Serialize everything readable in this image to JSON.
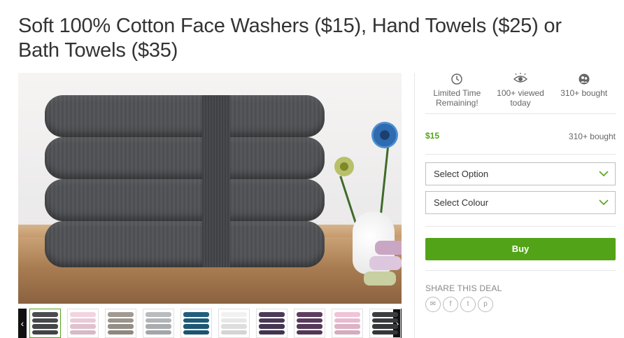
{
  "deal": {
    "title": "Soft 100% Cotton Face Washers ($15), Hand Towels ($25) or Bath Towels ($35)"
  },
  "gallery": {
    "prev_arrow": "‹",
    "next_arrow": "›",
    "thumbnail_colors": [
      "#4b4c4f",
      "#f2d3e0",
      "#a09a92",
      "#b9bcbf",
      "#1f5f7d",
      "#f1f1f1",
      "#4b3b5a",
      "#5e3d61",
      "#f0c3d7",
      "#3c3d40"
    ]
  },
  "stats": {
    "time": {
      "icon": "clock-icon",
      "line1": "Limited Time",
      "line2": "Remaining!"
    },
    "viewed": {
      "icon": "eye-icon",
      "line1": "100+ viewed",
      "line2": "today"
    },
    "bought": {
      "icon": "bought-icon",
      "line1": "310+ bought"
    }
  },
  "pricing": {
    "price": "$15",
    "bought": "310+ bought",
    "accent_color": "#53a318"
  },
  "options": {
    "option_select": "Select Option",
    "colour_select": "Select Colour"
  },
  "actions": {
    "buy_label": "Buy"
  },
  "share": {
    "title": "SHARE THIS DEAL",
    "icons": [
      "email-icon",
      "facebook-icon",
      "twitter-icon",
      "pinterest-icon"
    ],
    "glyphs": {
      "email": "✉",
      "facebook": "f",
      "twitter": "t",
      "pinterest": "p"
    }
  }
}
